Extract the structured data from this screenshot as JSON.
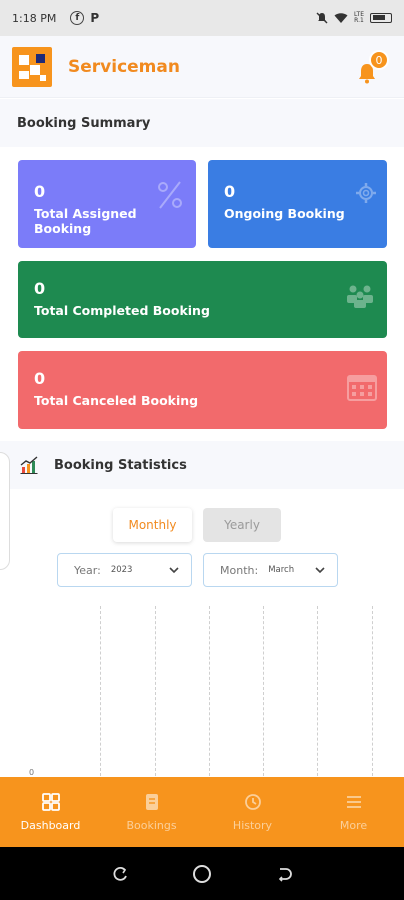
{
  "status_bar": {
    "time": "1:18 PM",
    "app_icons": [
      "facebook-icon",
      "p-icon"
    ],
    "network_label_top": "LTE",
    "network_label_bottom": "R.1"
  },
  "header": {
    "brand": "Serviceman",
    "notification_count": "0"
  },
  "booking_summary": {
    "title": "Booking Summary",
    "cards": [
      {
        "count": "0",
        "label": "Total Assigned Booking",
        "color": "#7b7cf9"
      },
      {
        "count": "0",
        "label": "Ongoing Booking",
        "color": "#3a7de3"
      },
      {
        "count": "0",
        "label": "Total Completed Booking",
        "color": "#1e8a50"
      },
      {
        "count": "0",
        "label": "Total Canceled Booking",
        "color": "#f26a6c"
      }
    ]
  },
  "booking_statistics": {
    "title": "Booking Statistics",
    "toggle": {
      "monthly": "Monthly",
      "yearly": "Yearly",
      "selected": "Monthly"
    },
    "year_select": {
      "label": "Year:",
      "value": "2023"
    },
    "month_select": {
      "label": "Month:",
      "value": "March"
    },
    "axis_zero": "0"
  },
  "bottom_nav": {
    "items": [
      {
        "label": "Dashboard",
        "icon": "dashboard-icon",
        "active": true
      },
      {
        "label": "Bookings",
        "icon": "bookings-icon",
        "active": false
      },
      {
        "label": "History",
        "icon": "history-icon",
        "active": false
      },
      {
        "label": "More",
        "icon": "menu-icon",
        "active": false
      }
    ]
  },
  "colors": {
    "accent": "#f7941d",
    "brand_text": "#f18a1f",
    "select_border": "#b9d7f0"
  }
}
